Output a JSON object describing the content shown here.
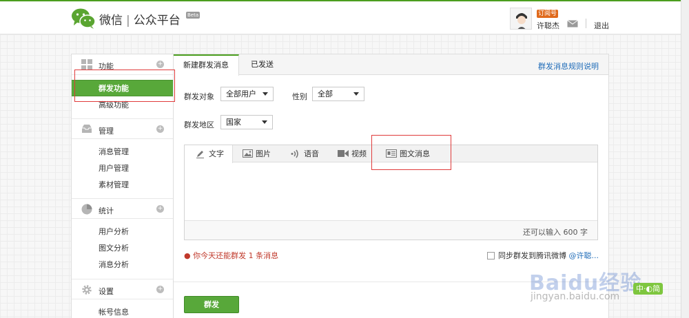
{
  "header": {
    "brand_name": "微信",
    "brand_sub": "公众平台",
    "beta": "Beta",
    "account_badge": "订阅号",
    "username": "许聪杰",
    "logout": "退出"
  },
  "sidebar": {
    "sections": [
      {
        "title": "功能",
        "icon": "function-grid-icon",
        "items": [
          "群发功能",
          "高级功能"
        ]
      },
      {
        "title": "管理",
        "icon": "inbox-icon",
        "items": [
          "消息管理",
          "用户管理",
          "素材管理"
        ]
      },
      {
        "title": "统计",
        "icon": "pie-chart-icon",
        "items": [
          "用户分析",
          "图文分析",
          "消息分析"
        ]
      },
      {
        "title": "设置",
        "icon": "gear-icon",
        "items": [
          "帐号信息"
        ]
      }
    ],
    "active_item": "群发功能"
  },
  "main": {
    "tabs": [
      "新建群发消息",
      "已发送"
    ],
    "rules_link": "群发消息规则说明",
    "form": {
      "target_label": "群发对象",
      "target_value": "全部用户",
      "gender_label": "性别",
      "gender_value": "全部",
      "region_label": "群发地区",
      "region_value": "国家"
    },
    "editor": {
      "tabs": [
        {
          "label": "文字",
          "icon": "pencil-icon"
        },
        {
          "label": "图片",
          "icon": "image-icon"
        },
        {
          "label": "语音",
          "icon": "voice-icon"
        },
        {
          "label": "视频",
          "icon": "video-icon"
        },
        {
          "label": "图文消息",
          "icon": "news-icon"
        }
      ],
      "counter": "还可以输入 600 字"
    },
    "notice": "你今天还能群发 1 条消息",
    "sync_label": "同步群发到腾讯微博",
    "sync_handle": "@许聪...",
    "send_button": "群发"
  },
  "overlay": {
    "watermark": "Baidu经验",
    "watermark_url": "jingyan.baidu.com",
    "ime": "中·◐简"
  },
  "colors": {
    "accent_green": "#58a83a",
    "link_blue": "#1e6bb8",
    "notice_red": "#c0392b",
    "annotation_red": "#e03a3a"
  }
}
